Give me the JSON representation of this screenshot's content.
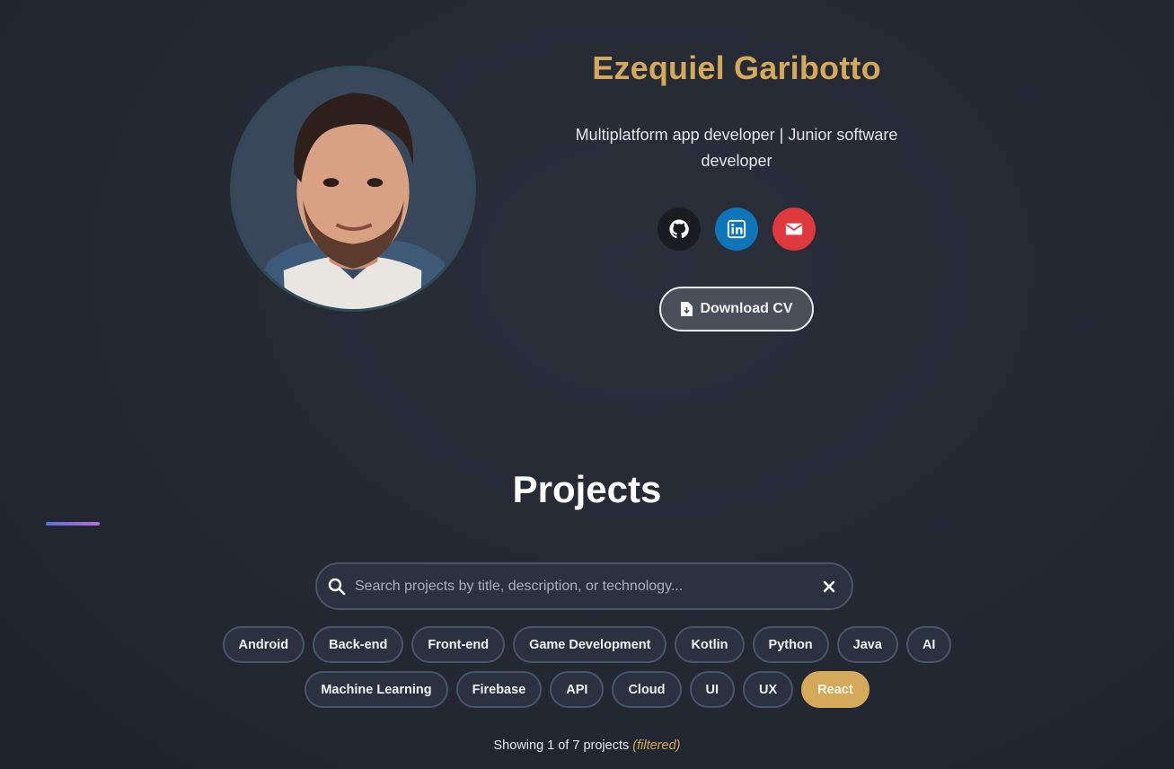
{
  "profile": {
    "name": "Ezequiel Garibotto",
    "tagline": "Multiplatform app developer | Junior software developer",
    "socials": [
      {
        "name": "github",
        "icon": "github-icon",
        "color": "#1a1c22"
      },
      {
        "name": "linkedin",
        "icon": "linkedin-icon",
        "color": "#0e76b8"
      },
      {
        "name": "email",
        "icon": "envelope-icon",
        "color": "#e0393d"
      }
    ],
    "cv_button": {
      "label": "Download CV",
      "icon": "file-download-icon"
    }
  },
  "projects": {
    "title": "Projects",
    "search": {
      "placeholder": "Search projects by title, description, or technology...",
      "value": ""
    },
    "filters_row1": [
      "Android",
      "Back-end",
      "Front-end",
      "Game Development",
      "Kotlin",
      "Python",
      "Java",
      "AI"
    ],
    "filters_row2": [
      "Machine Learning",
      "Firebase",
      "API",
      "Cloud",
      "UI",
      "UX",
      "React"
    ],
    "active_filter": "React",
    "showing": {
      "text": "Showing 1 of 7 projects",
      "note": "(filtered)"
    }
  },
  "colors": {
    "accent": "#d4a959",
    "background": "#252934",
    "chip_bg": "#2a3140"
  }
}
